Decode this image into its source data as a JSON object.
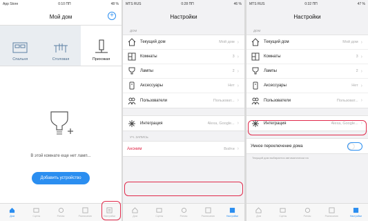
{
  "colors": {
    "accent": "#2b8ef0",
    "highlight": "#e0294a"
  },
  "panel1": {
    "status": {
      "left": "App Store",
      "time": "0:10 ПП",
      "right": "48 %"
    },
    "title": "Мой дом",
    "plus": "+",
    "rooms": [
      {
        "label": "Спальня",
        "icon": "bed-icon"
      },
      {
        "label": "Столовая",
        "icon": "dining-table-icon"
      },
      {
        "label": "Прихожая",
        "icon": "hallway-icon"
      }
    ],
    "empty_text": "В этой комнате еще нет ламп...",
    "add_button": "Добавить устройство"
  },
  "panel2": {
    "status": {
      "left": "MTS RUS",
      "time": "0:28 ПП",
      "right": "46 %"
    },
    "title": "Настройки",
    "section_home": "дом",
    "rows": [
      {
        "label": "Текущий дом",
        "value": "Мой дом",
        "icon": "home-icon"
      },
      {
        "label": "Комнаты",
        "value": "3",
        "icon": "rooms-icon"
      },
      {
        "label": "Лампы",
        "value": "2",
        "icon": "lamp-icon"
      },
      {
        "label": "Аксессуары",
        "value": "Нет",
        "icon": "accessory-icon"
      },
      {
        "label": "Пользователи",
        "value": "Пользоват...",
        "icon": "users-icon"
      }
    ],
    "integration": {
      "label": "Интеграция",
      "value": "Alexa, Google...",
      "icon": "integration-icon"
    },
    "section_account": "уч. запись",
    "account": {
      "label": "Аноним",
      "value": "Войти"
    }
  },
  "panel3": {
    "status": {
      "left": "MTS RUS",
      "time": "0:32 ПП",
      "right": "47 %"
    },
    "title": "Настройки",
    "section_home": "дом",
    "rows": [
      {
        "label": "Текущий дом",
        "value": "Мой дом",
        "icon": "home-icon"
      },
      {
        "label": "Комнаты",
        "value": "3",
        "icon": "rooms-icon"
      },
      {
        "label": "Лампы",
        "value": "2",
        "icon": "lamp-icon"
      },
      {
        "label": "Аксессуары",
        "value": "Нет",
        "icon": "accessory-icon"
      },
      {
        "label": "Пользователи",
        "value": "Пользоват...",
        "icon": "users-icon"
      }
    ],
    "integration": {
      "label": "Интеграция",
      "value": "Alexa, Google...",
      "icon": "integration-icon"
    },
    "smart_switch": "Умное переключение дома",
    "note": "Текущий дом выбирается автоматически на"
  },
  "tabs": [
    "Дом",
    "Сцены",
    "Ритмы",
    "Расписания",
    "Настройки"
  ]
}
